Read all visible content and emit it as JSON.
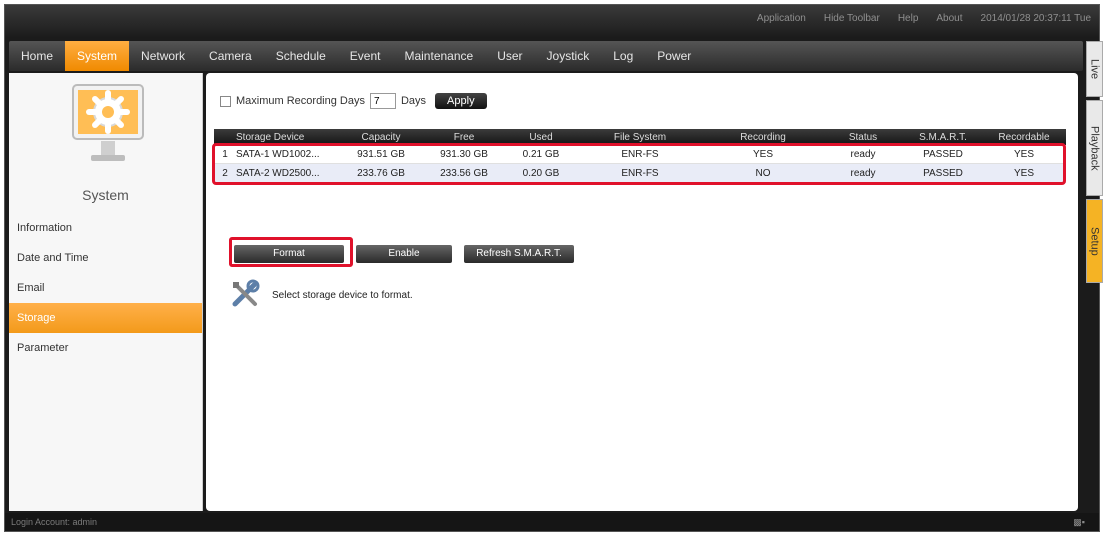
{
  "toolbar": {
    "links": [
      "Application",
      "Hide Toolbar",
      "Help",
      "About",
      "2014/01/28 20:37:11 Tue"
    ]
  },
  "nav": {
    "items": [
      "Home",
      "System",
      "Network",
      "Camera",
      "Schedule",
      "Event",
      "Maintenance",
      "User",
      "Joystick",
      "Log",
      "Power"
    ],
    "active": "System"
  },
  "sidebar": {
    "title": "System",
    "items": [
      "Information",
      "Date and Time",
      "Email",
      "Storage",
      "Parameter"
    ],
    "active": "Storage"
  },
  "storage": {
    "max_days_label": "Maximum Recording Days",
    "max_days_value": "7",
    "days_unit": "Days",
    "apply_label": "Apply",
    "columns": [
      "",
      "Storage Device",
      "Capacity",
      "Free",
      "Used",
      "File System",
      "Recording",
      "Status",
      "S.M.A.R.T.",
      "Recordable"
    ],
    "rows": [
      [
        "1",
        "SATA-1 WD1002...",
        "931.51 GB",
        "931.30 GB",
        "0.21 GB",
        "ENR-FS",
        "YES",
        "ready",
        "PASSED",
        "YES"
      ],
      [
        "2",
        "SATA-2 WD2500...",
        "233.76 GB",
        "233.56 GB",
        "0.20 GB",
        "ENR-FS",
        "NO",
        "ready",
        "PASSED",
        "YES"
      ]
    ],
    "buttons": {
      "format": "Format",
      "enable": "Enable",
      "refresh": "Refresh S.M.A.R.T."
    },
    "hint": "Select storage device to format."
  },
  "right_tabs": [
    "Live",
    "Playback",
    "Setup"
  ],
  "right_tab_active": "Setup",
  "status": {
    "login": "Login Account: admin"
  },
  "colors": {
    "accent": "#f39a1a",
    "highlight": "#e0112b"
  }
}
